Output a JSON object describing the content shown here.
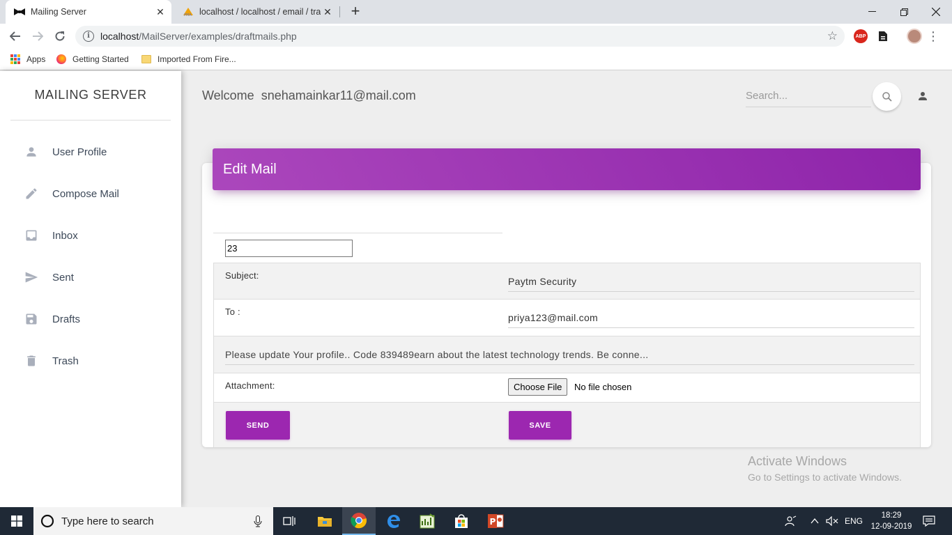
{
  "browser": {
    "tabs": [
      {
        "title": "Mailing Server",
        "active": true
      },
      {
        "title": "localhost / localhost / email / tra",
        "active": false
      }
    ],
    "url_host": "localhost",
    "url_path": "/MailServer/examples/draftmails.php",
    "bookmarks": [
      "Apps",
      "Getting Started",
      "Imported From Fire..."
    ],
    "extension_abp": "ABP"
  },
  "sidebar": {
    "brand": "MAILING SERVER",
    "items": [
      {
        "label": "User Profile",
        "icon": "person-icon"
      },
      {
        "label": "Compose Mail",
        "icon": "pencil-icon"
      },
      {
        "label": "Inbox",
        "icon": "inbox-icon"
      },
      {
        "label": "Sent",
        "icon": "send-icon"
      },
      {
        "label": "Drafts",
        "icon": "save-icon"
      },
      {
        "label": "Trash",
        "icon": "trash-icon"
      }
    ]
  },
  "header": {
    "welcome": "Welcome  snehamainkar11@mail.com",
    "search_placeholder": "Search..."
  },
  "card": {
    "title": "Edit Mail",
    "id_value": "23",
    "subject_label": "Subject:",
    "subject_value": "Paytm Security",
    "to_label": "To :",
    "to_value": "priya123@mail.com",
    "body": "Please update Your profile.. Code 839489earn about the latest technology trends. Be conne...",
    "attachment_label": "Attachment:",
    "choose_file": "Choose File",
    "file_status": "No file chosen",
    "send_label": "SEND",
    "save_label": "SAVE"
  },
  "watermark": {
    "title": "Activate Windows",
    "subtitle": "Go to Settings to activate Windows."
  },
  "taskbar": {
    "search_text": "Type here to search",
    "lang": "ENG",
    "time": "18:29",
    "date": "12-09-2019"
  },
  "colors": {
    "accent": "#9c27b0",
    "header_gradient_start": "#ab47bc",
    "header_gradient_end": "#8e24aa",
    "taskbar": "#1f2936"
  }
}
